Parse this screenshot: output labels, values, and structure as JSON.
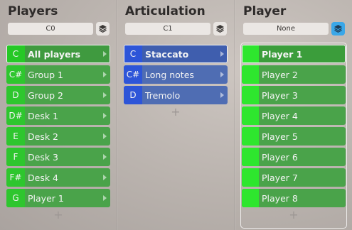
{
  "players": {
    "title": "Players",
    "note_field": "C0",
    "items": [
      {
        "note": "C",
        "label": "All players",
        "selected": true
      },
      {
        "note": "C#",
        "label": "Group 1"
      },
      {
        "note": "D",
        "label": "Group 2"
      },
      {
        "note": "D#",
        "label": "Desk 1"
      },
      {
        "note": "E",
        "label": "Desk 2"
      },
      {
        "note": "F",
        "label": "Desk 3"
      },
      {
        "note": "F#",
        "label": "Desk 4"
      },
      {
        "note": "G",
        "label": "Player 1"
      }
    ],
    "add_label": "+"
  },
  "articulation": {
    "title": "Articulation",
    "note_field": "C1",
    "items": [
      {
        "note": "C",
        "label": "Staccato",
        "selected": true
      },
      {
        "note": "C#",
        "label": "Long notes"
      },
      {
        "note": "D",
        "label": "Tremolo"
      }
    ],
    "add_label": "+"
  },
  "player": {
    "title": "Player",
    "note_field": "None",
    "items": [
      {
        "label": "Player 1",
        "selected": true
      },
      {
        "label": "Player 2"
      },
      {
        "label": "Player 3"
      },
      {
        "label": "Player 4"
      },
      {
        "label": "Player 5"
      },
      {
        "label": "Player 6"
      },
      {
        "label": "Player 7"
      },
      {
        "label": "Player 8"
      }
    ],
    "add_label": "+"
  },
  "colors": {
    "green_item": "#4aa34a",
    "green_note": "#2ec62e",
    "blue_item": "#4f6db3",
    "blue_note": "#2d55d8",
    "layer_active": "#3aa7e8"
  },
  "icons": {
    "layer": "layers-icon",
    "arrow": "chevron-right-icon",
    "add": "plus-icon"
  }
}
